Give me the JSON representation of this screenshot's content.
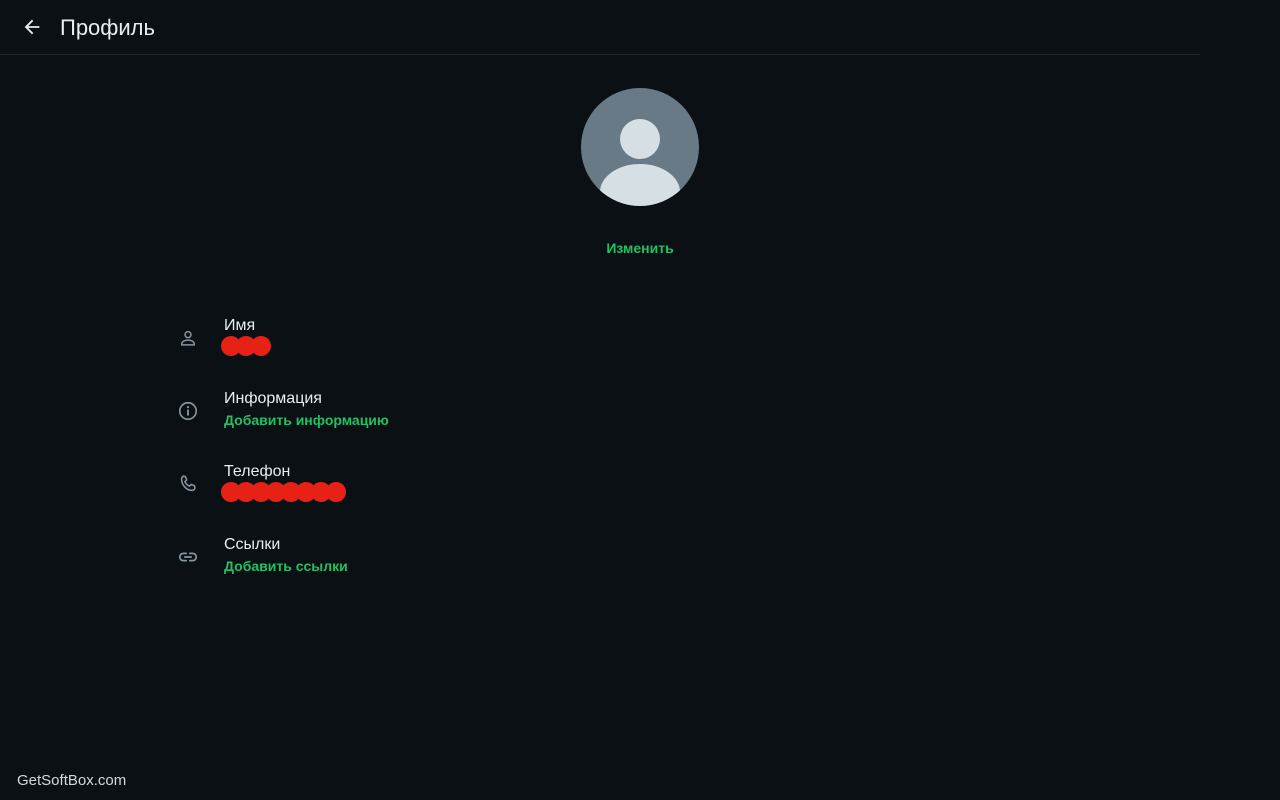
{
  "header": {
    "title": "Профиль",
    "back_icon": "arrow-left-icon"
  },
  "profile": {
    "avatar_icon": "default-avatar-icon",
    "change_label": "Изменить"
  },
  "rows": [
    {
      "label": "Имя",
      "icon": "person-icon",
      "value": "redacted"
    },
    {
      "label": "Информация",
      "icon": "info-icon",
      "action": "Добавить информацию"
    },
    {
      "label": "Телефон",
      "icon": "phone-icon",
      "value": "redacted"
    },
    {
      "label": "Ссылки",
      "icon": "link-icon",
      "action": "Добавить ссылки"
    }
  ],
  "watermark": "GetSoftBox.com",
  "colors": {
    "background": "#0b1014",
    "accent": "#21c063",
    "text": "#e9edef",
    "redaction": "#e82117"
  }
}
